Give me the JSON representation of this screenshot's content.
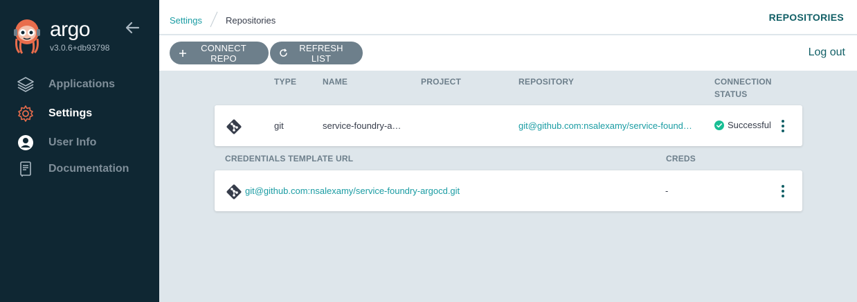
{
  "sidebar": {
    "brand": "argo",
    "version": "v3.0.6+db93798",
    "items": [
      {
        "label": "Applications",
        "icon": "layers-icon",
        "active": false
      },
      {
        "label": "Settings",
        "icon": "gear-icon",
        "active": true
      },
      {
        "label": "User Info",
        "icon": "user-icon",
        "active": false
      },
      {
        "label": "Documentation",
        "icon": "book-icon",
        "active": false
      }
    ]
  },
  "breadcrumb": {
    "parent": "Settings",
    "current": "Repositories"
  },
  "header": {
    "title": "REPOSITORIES"
  },
  "toolbar": {
    "connect_label": "CONNECT REPO",
    "refresh_label": "REFRESH LIST",
    "logout_label": "Log out"
  },
  "repos_table": {
    "columns": {
      "type": "TYPE",
      "name": "NAME",
      "project": "PROJECT",
      "repository": "REPOSITORY",
      "status_line1": "CONNECTION",
      "status_line2": "STATUS"
    },
    "rows": [
      {
        "type": "git",
        "name": "service-foundry-a…",
        "project": "",
        "repository": "git@github.com:nsalexamy/service-found…",
        "status": "Successful"
      }
    ]
  },
  "creds_table": {
    "columns": {
      "url": "CREDENTIALS TEMPLATE URL",
      "creds": "CREDS"
    },
    "rows": [
      {
        "url": "git@github.com:nsalexamy/service-foundry-argocd.git",
        "creds": "-"
      }
    ]
  },
  "colors": {
    "sidebar_bg": "#0f2733",
    "accent": "#1a9ca3",
    "heading": "#115f66",
    "button_bg": "#6d7f8b",
    "success": "#18be94",
    "content_bg": "#dee6eb"
  }
}
